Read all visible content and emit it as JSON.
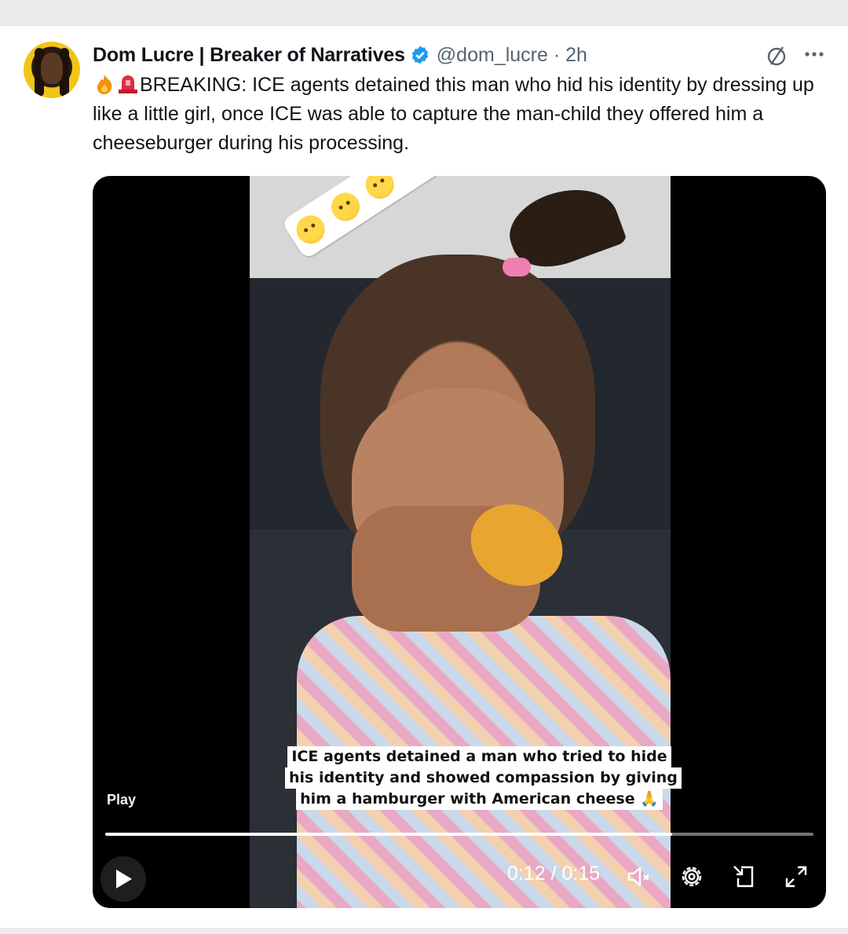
{
  "post": {
    "author_name": "Dom Lucre | Breaker of Narratives",
    "handle_time": "@dom_lucre · 2h",
    "text_prefix_icons": [
      "fire-emoji",
      "siren-emoji"
    ],
    "text": "BREAKING: ICE agents detained this man who hid his identity by dressing up like a little girl, once ICE was able to capture the man-child they offered him a cheeseburger during his processing."
  },
  "video": {
    "caption_lines": [
      "ICE agents detained a man who tried to hide",
      "his identity and showed compassion by giving",
      "him a hamburger with American cheese 🙏"
    ],
    "play_label": "Play",
    "time": "0:12 / 0:15",
    "progress": 0.8,
    "sticker_emojis": [
      "relieved-face",
      "worried-face",
      "slightly-smiling-face",
      "crying-face"
    ]
  },
  "colors": {
    "verified": "#1d9bf0",
    "text": "#0f1419",
    "muted": "#536471"
  }
}
